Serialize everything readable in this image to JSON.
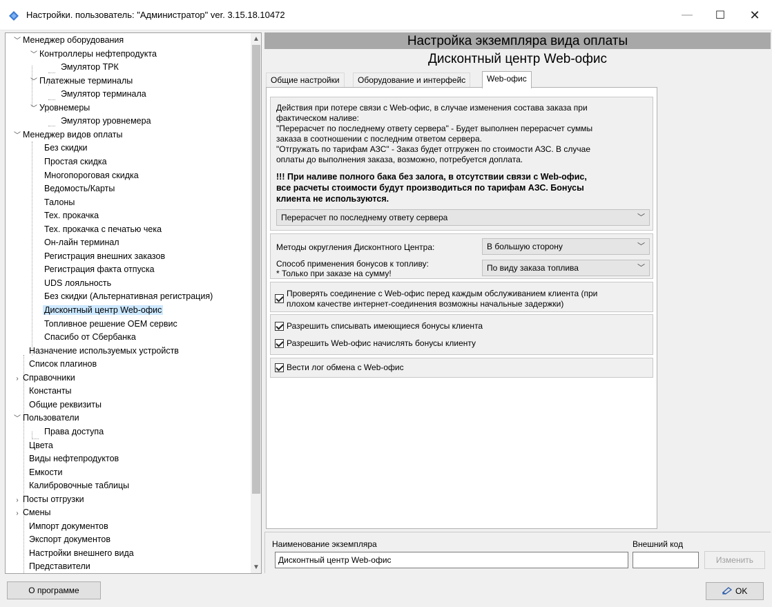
{
  "window": {
    "title": "Настройки. пользователь: \"Администратор\" ver. 3.15.18.10472",
    "minimize": "—",
    "maximize": "☐",
    "close": "✕"
  },
  "tree": {
    "items": [
      {
        "label": "Менеджер оборудования"
      },
      {
        "label": "Контроллеры нефтепродукта"
      },
      {
        "label": "Эмулятор ТРК"
      },
      {
        "label": "Платежные терминалы"
      },
      {
        "label": "Эмулятор терминала"
      },
      {
        "label": "Уровнемеры"
      },
      {
        "label": "Эмулятор уровнемера"
      },
      {
        "label": "Менеджер видов оплаты"
      },
      {
        "label": "Без скидки"
      },
      {
        "label": "Простая скидка"
      },
      {
        "label": "Многопороговая скидка"
      },
      {
        "label": "Ведомость/Карты"
      },
      {
        "label": "Талоны"
      },
      {
        "label": "Тех. прокачка"
      },
      {
        "label": "Тех. прокачка с печатью чека"
      },
      {
        "label": "Он-лайн терминал"
      },
      {
        "label": "Регистрация внешних заказов"
      },
      {
        "label": "Регистрация факта отпуска"
      },
      {
        "label": "UDS лояльность"
      },
      {
        "label": "Без скидки (Альтернативная регистрация)"
      },
      {
        "label": "Дисконтный центр Web-офис"
      },
      {
        "label": "Топливное решение OEM сервис"
      },
      {
        "label": "Спасибо от Сбербанка"
      },
      {
        "label": "Назначение используемых устройств"
      },
      {
        "label": "Список плагинов"
      },
      {
        "label": "Справочники"
      },
      {
        "label": "Константы"
      },
      {
        "label": "Общие реквизиты"
      },
      {
        "label": "Пользователи"
      },
      {
        "label": "Права доступа"
      },
      {
        "label": "Цвета"
      },
      {
        "label": "Виды нефтепродуктов"
      },
      {
        "label": "Емкости"
      },
      {
        "label": "Калибровочные таблицы"
      },
      {
        "label": "Посты отгрузки"
      },
      {
        "label": "Смены"
      },
      {
        "label": "Импорт документов"
      },
      {
        "label": "Экспорт документов"
      },
      {
        "label": "Настройки внешнего вида"
      },
      {
        "label": "Представители"
      }
    ],
    "selected": "Дисконтный центр Web-офис"
  },
  "panel": {
    "header": "Настройка экземпляра вида оплаты",
    "subheader": "Дисконтный центр Web-офис",
    "tabs": [
      {
        "label": "Общие настройки"
      },
      {
        "label": "Оборудование и интерфейс"
      },
      {
        "label": "Web-офис"
      }
    ],
    "active_tab": "Web-офис",
    "desc": {
      "line1": "Действия при потере связи с Web-офис, в случае изменения состава заказа при",
      "line2": "фактическом наливе:",
      "line3": "\"Перерасчет по последнему ответу сервера\" - Будет выполнен перерасчет суммы",
      "line4": "заказа в соотношении с последним ответом сервера.",
      "line5": "\"Отгружать по тарифам АЗС\" - Заказ будет отгружен по стоимости АЗС. В случае",
      "line6": "оплаты до выполнения заказа, возможно, потребуется доплата."
    },
    "warning": {
      "line1": "!!! При наливе полного бака без залога, в отсутствии связи с Web-офис,",
      "line2": "все расчеты стоимости будут производиться по тарифам АЗС. Бонусы",
      "line3": "клиента не используются."
    },
    "loss_action_value": "Перерасчет по последнему ответу сервера",
    "rounding_label": "Методы округления Дисконтного Центра:",
    "rounding_value": "В большую сторону",
    "bonus_label1": "Способ применения бонусов к топливу:",
    "bonus_label2": "* Только при заказе на сумму!",
    "bonus_value": "По виду заказа топлива",
    "check_conn_line1": "Проверять соединение с Web-офис перед каждым обслуживанием клиента (при",
    "check_conn_line2": "плохом качестве интернет-соединения возможны начальные задержки)",
    "allow_spend": "Разрешить списывать имеющиеся бонусы клиента",
    "allow_accrue": "Разрешить Web-офис начислять бонусы клиенту",
    "log_exchange": "Вести лог обмена с Web-офис",
    "chevron": "﹀"
  },
  "instance": {
    "name_label": "Наименование экземпляра",
    "name_value": "Дисконтный центр Web-офис",
    "code_label": "Внешний код",
    "code_value": "",
    "change_button": "Изменить"
  },
  "footer": {
    "about_button": "О программе",
    "ok_button": "OK"
  }
}
